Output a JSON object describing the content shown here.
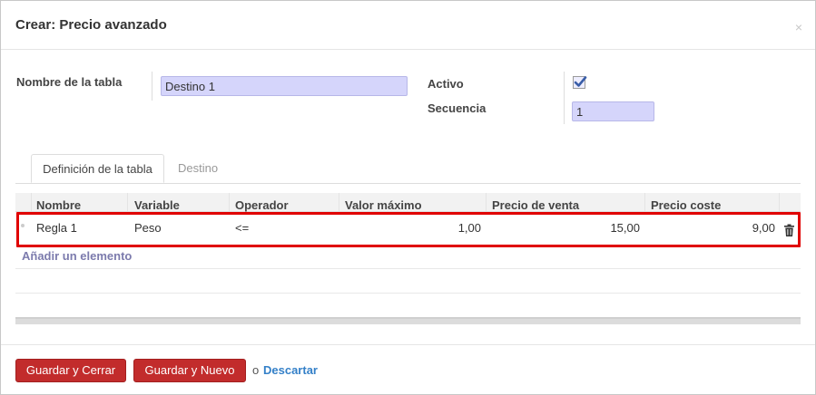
{
  "dialog": {
    "title": "Crear: Precio avanzado",
    "close_label": "×"
  },
  "form": {
    "name_label": "Nombre de la tabla",
    "name_value": "Destino 1",
    "active_label": "Activo",
    "active_checked": true,
    "sequence_label": "Secuencia",
    "sequence_value": "1"
  },
  "tabs": [
    {
      "label": "Definición de la tabla",
      "active": true
    },
    {
      "label": "Destino",
      "active": false
    }
  ],
  "table": {
    "columns": [
      "Nombre",
      "Variable",
      "Operador",
      "Valor máximo",
      "Precio de venta",
      "Precio coste"
    ],
    "rows": [
      {
        "name": "Regla 1",
        "variable": "Peso",
        "operator": "<=",
        "max_value": "1,00",
        "sale_price": "15,00",
        "cost_price": "9,00"
      }
    ],
    "add_label": "Añadir un elemento"
  },
  "footer": {
    "save_close_label": "Guardar y Cerrar",
    "save_new_label": "Guardar y Nuevo",
    "or_label": "o",
    "discard_label": "Descartar"
  },
  "colors": {
    "primary_button": "#c22c2c",
    "link": "#3480c8",
    "input_bg": "#d5d5fb",
    "highlight": "#e00000"
  },
  "icons": [
    "close-icon",
    "checkbox-icon",
    "trash-icon",
    "drag-handle-icon"
  ]
}
